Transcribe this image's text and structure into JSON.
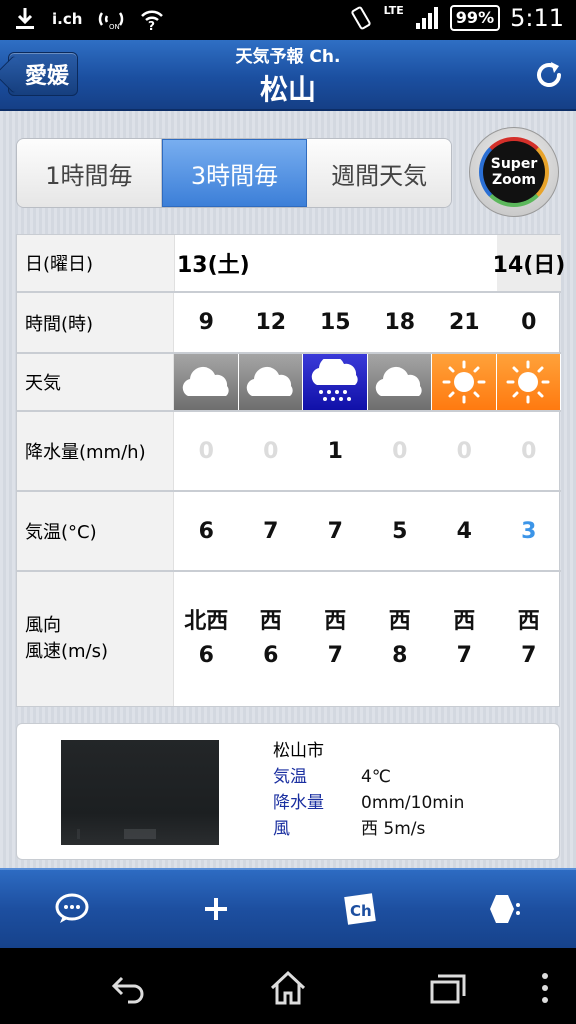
{
  "status_bar": {
    "left_icons": [
      "download-icon",
      "ich-icon",
      "nfc-icon",
      "wifi-icon"
    ],
    "ich_label": "i.ch",
    "lte_label": "LTE",
    "battery": "99%",
    "time": "5:11"
  },
  "header": {
    "back_label": "愛媛",
    "subtitle": "天気予報 Ch.",
    "title": "松山"
  },
  "tabs": [
    {
      "label": "1時間毎",
      "active": false
    },
    {
      "label": "3時間毎",
      "active": true
    },
    {
      "label": "週間天気",
      "active": false
    }
  ],
  "superzoom": {
    "line1": "Super",
    "line2": "Zoom"
  },
  "forecast": {
    "labels": {
      "date": "日(曜日)",
      "time": "時間(時)",
      "weather": "天気",
      "precip": "降水量(mm/h)",
      "temp": "気温(°C)",
      "wind1": "風向",
      "wind2": "風速(m/s)"
    },
    "date1": "13(土)",
    "date2": "14(日)",
    "hours": [
      "9",
      "12",
      "15",
      "18",
      "21",
      "0"
    ],
    "weather": [
      "cloudy",
      "cloudy",
      "rain",
      "cloudy",
      "sunny",
      "sunny"
    ],
    "precip": [
      "0",
      "0",
      "1",
      "0",
      "0",
      "0"
    ],
    "temp": [
      "6",
      "7",
      "7",
      "5",
      "4",
      "3"
    ],
    "wind_dir": [
      "北西",
      "西",
      "西",
      "西",
      "西",
      "西"
    ],
    "wind_speed": [
      "6",
      "6",
      "7",
      "8",
      "7",
      "7"
    ]
  },
  "live": {
    "city": "松山市",
    "rows": [
      {
        "key": "気温",
        "value": "4℃"
      },
      {
        "key": "降水量",
        "value": "0mm/10min"
      },
      {
        "key": "風",
        "value": "西 5m/s"
      }
    ]
  },
  "toolbar": {
    "items": [
      "chat-icon",
      "add-icon",
      "channel-icon",
      "settings-icon"
    ],
    "ch_label": "Ch"
  },
  "nav": [
    "back-icon",
    "home-icon",
    "recent-apps-icon",
    "menu-icon"
  ],
  "colors": {
    "header": "#1b4fa0",
    "active_tab": "#3c7fd8",
    "rain": "#1010a8",
    "sunny": "#ff7a10",
    "cold_temp": "#3c95e8"
  }
}
